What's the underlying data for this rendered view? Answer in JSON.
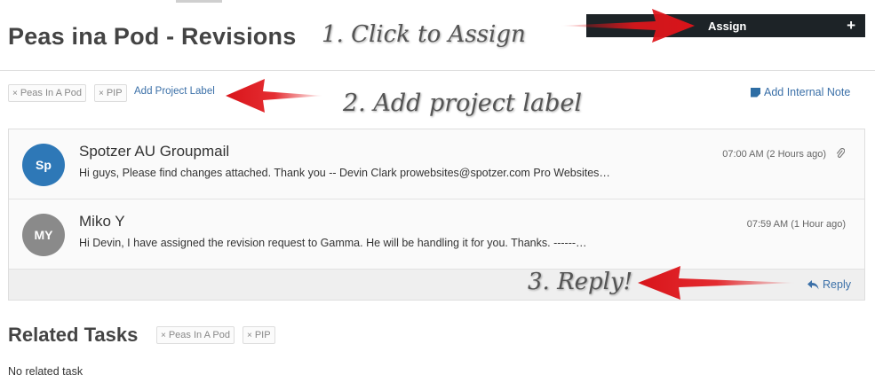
{
  "page": {
    "title": "Peas ina Pod - Revisions"
  },
  "annotations": {
    "step1": "1. Click to Assign",
    "step2": "2. Add project label",
    "step3": "3. Reply!"
  },
  "assign": {
    "label": "Assign",
    "plus": "+"
  },
  "project_labels": {
    "tags": [
      "Peas In A Pod",
      "PIP"
    ],
    "remove_glyph": "×",
    "add_link": "Add Project Label"
  },
  "internal_note": {
    "label": "Add Internal Note",
    "icon": "note-icon"
  },
  "messages": [
    {
      "initials": "Sp",
      "avatar_color": "#2e78b7",
      "sender": "Spotzer AU Groupmail",
      "time": "07:00 AM (2 Hours ago)",
      "snippet": "Hi guys, Please find changes attached. Thank you -- Devin Clark prowebsites@spotzer.com Pro Websites…",
      "attachment_icon": "paperclip-icon"
    },
    {
      "initials": "MY",
      "avatar_color": "#8a8a8a",
      "sender": "Miko Y",
      "time": "07:59 AM (1 Hour ago)",
      "snippet": "Hi Devin, I have assigned the revision request to Gamma. He will be handling it for you. Thanks. ------…"
    }
  ],
  "reply": {
    "label": "Reply",
    "icon": "reply-icon"
  },
  "related_tasks": {
    "title": "Related Tasks",
    "tags": [
      "Peas In A Pod",
      "PIP"
    ],
    "empty_text": "No related task"
  },
  "colors": {
    "link": "#3b70a8",
    "assign_bg": "#1d2327",
    "arrow_red": "#e2161b"
  }
}
